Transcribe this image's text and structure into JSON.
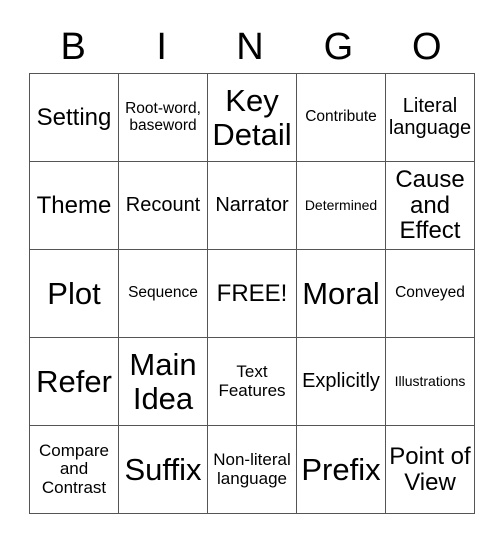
{
  "header": {
    "letters": [
      "B",
      "I",
      "N",
      "G",
      "O"
    ]
  },
  "grid": {
    "rows": [
      [
        "Setting",
        "Root-word, baseword",
        "Key Detail",
        "Contribute",
        "Literal language"
      ],
      [
        "Theme",
        "Recount",
        "Narrator",
        "Determined",
        "Cause and Effect"
      ],
      [
        "Plot",
        "Sequence",
        "FREE!",
        "Moral",
        "Conveyed"
      ],
      [
        "Refer",
        "Main Idea",
        "Text Features",
        "Explicitly",
        "Illustrations"
      ],
      [
        "Compare and Contrast",
        "Suffix",
        "Non-literal language",
        "Prefix",
        "Point of View"
      ]
    ]
  }
}
